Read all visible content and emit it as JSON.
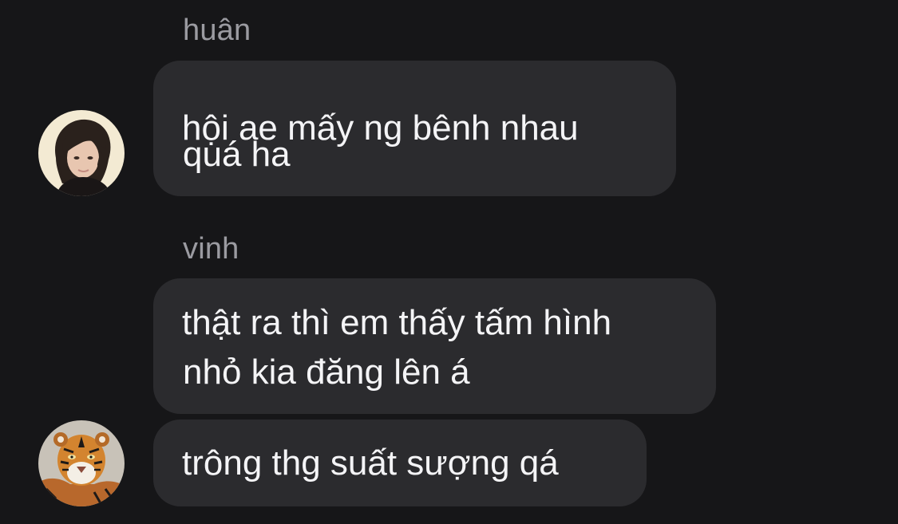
{
  "conversation": {
    "messages": [
      {
        "sender": "huân",
        "lines": [
          "hội ae mấy ng bênh nhau",
          "quá ha"
        ]
      },
      {
        "sender": "vinh",
        "lines": [
          "thật ra thì em thấy tấm hình",
          "nhỏ kia đăng lên á"
        ]
      },
      {
        "sender": "vinh",
        "lines": [
          "trông thg suất sượng qá"
        ]
      }
    ]
  },
  "avatars": {
    "huan": {
      "icon": "person-photo-avatar",
      "bg": "#f3ead3"
    },
    "vinh": {
      "icon": "tiger-photo-avatar",
      "bg": "#c8c2b8"
    }
  },
  "colors": {
    "background": "#161618",
    "bubble": "#2b2b2e",
    "sender_text": "#9b9ba1",
    "message_text": "#f4f4f6"
  }
}
